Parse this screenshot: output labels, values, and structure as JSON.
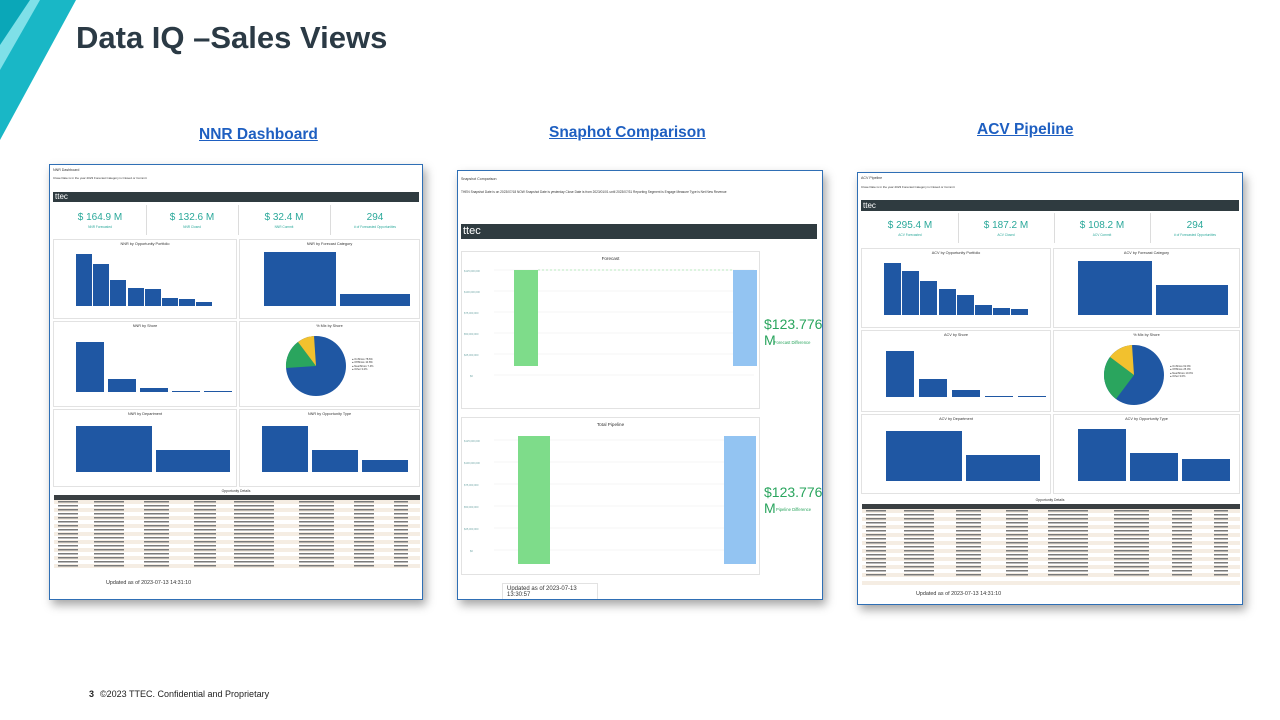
{
  "slide": {
    "title": "Data IQ –Sales Views",
    "footer_page": "3",
    "footer_text": "©2023 TTEC. Confidential and Proprietary",
    "colors": {
      "title": "#2b3a45",
      "link": "#1e5fc1",
      "accent_teal": "#2aa89a",
      "bar_blue": "#1f57a3",
      "green": "#2aa55e"
    }
  },
  "sections": [
    {
      "label": "NNR Dashboard"
    },
    {
      "label": "Snaphot Comparison"
    },
    {
      "label": "ACV Pipeline "
    }
  ],
  "nnr": {
    "header": "NNR Dashboard",
    "filter": "Close Date is in the year 2023   Forecast Category is Closed or Commit",
    "logo": "ttec",
    "kpis": [
      {
        "value": "$ 164.9 M",
        "label": "NNR Forecasted"
      },
      {
        "value": "$ 132.6 M",
        "label": "NNR Closed"
      },
      {
        "value": "$ 32.4 M",
        "label": "NNR Commit"
      },
      {
        "value": "294",
        "label": "# of Forecasted Opportunities"
      }
    ],
    "panels": {
      "portfolio": "NNR by Opportunity Portfolio",
      "forecast_cat": "NNR by Forecast Category",
      "shore": "NNR by Shore",
      "mix": "% Mix by Shore",
      "department": "NNR by Department",
      "opp_type": "NNR by Opportunity Type"
    },
    "table_title": "Opportunity Details",
    "updated": "Updated as of 2023-07-13 14:31:10"
  },
  "snap": {
    "header": "Snapshot Comparison",
    "filter": "THEN Snapshot Date is on 2023/07/18   NOW Snapshot Date is yesterday   Close Date is from 2023/01/01 until 2023/07/31   Reporting Segment is Engage   Measure Type is Net New Revenue",
    "logo": "ttec",
    "chart1_title": "Forecast",
    "chart1_value": "$123.776 M",
    "chart1_caption": "Forecast Difference",
    "chart2_title": "Total Pipeline",
    "chart2_value": "$123.776 M",
    "chart2_caption": "Pipeline Difference",
    "updated": "Updated as of 2023-07-13 13:30:57"
  },
  "acv": {
    "header": "ACV Pipeline",
    "filter": "Close Date is in the year 2023   Forecast Category is Closed or Commit",
    "logo": "ttec",
    "kpis": [
      {
        "value": "$ 295.4 M",
        "label": "ACV Forecasted"
      },
      {
        "value": "$ 187.2 M",
        "label": "ACV Closed"
      },
      {
        "value": "$ 108.2 M",
        "label": "ACV Commit"
      },
      {
        "value": "294",
        "label": "# of Forecasted Opportunities"
      }
    ],
    "panels": {
      "portfolio": "ACV by Opportunity Portfolio",
      "forecast_cat": "ACV by Forecast Category",
      "shore": "ACV by Shore",
      "mix": "% Mix by Shore",
      "department": "ACV by Department",
      "opp_type": "ACV by Opportunity Type"
    },
    "table_title": "Opportunity Details",
    "updated": "Updated as of 2023-07-13 14:31:10"
  }
}
